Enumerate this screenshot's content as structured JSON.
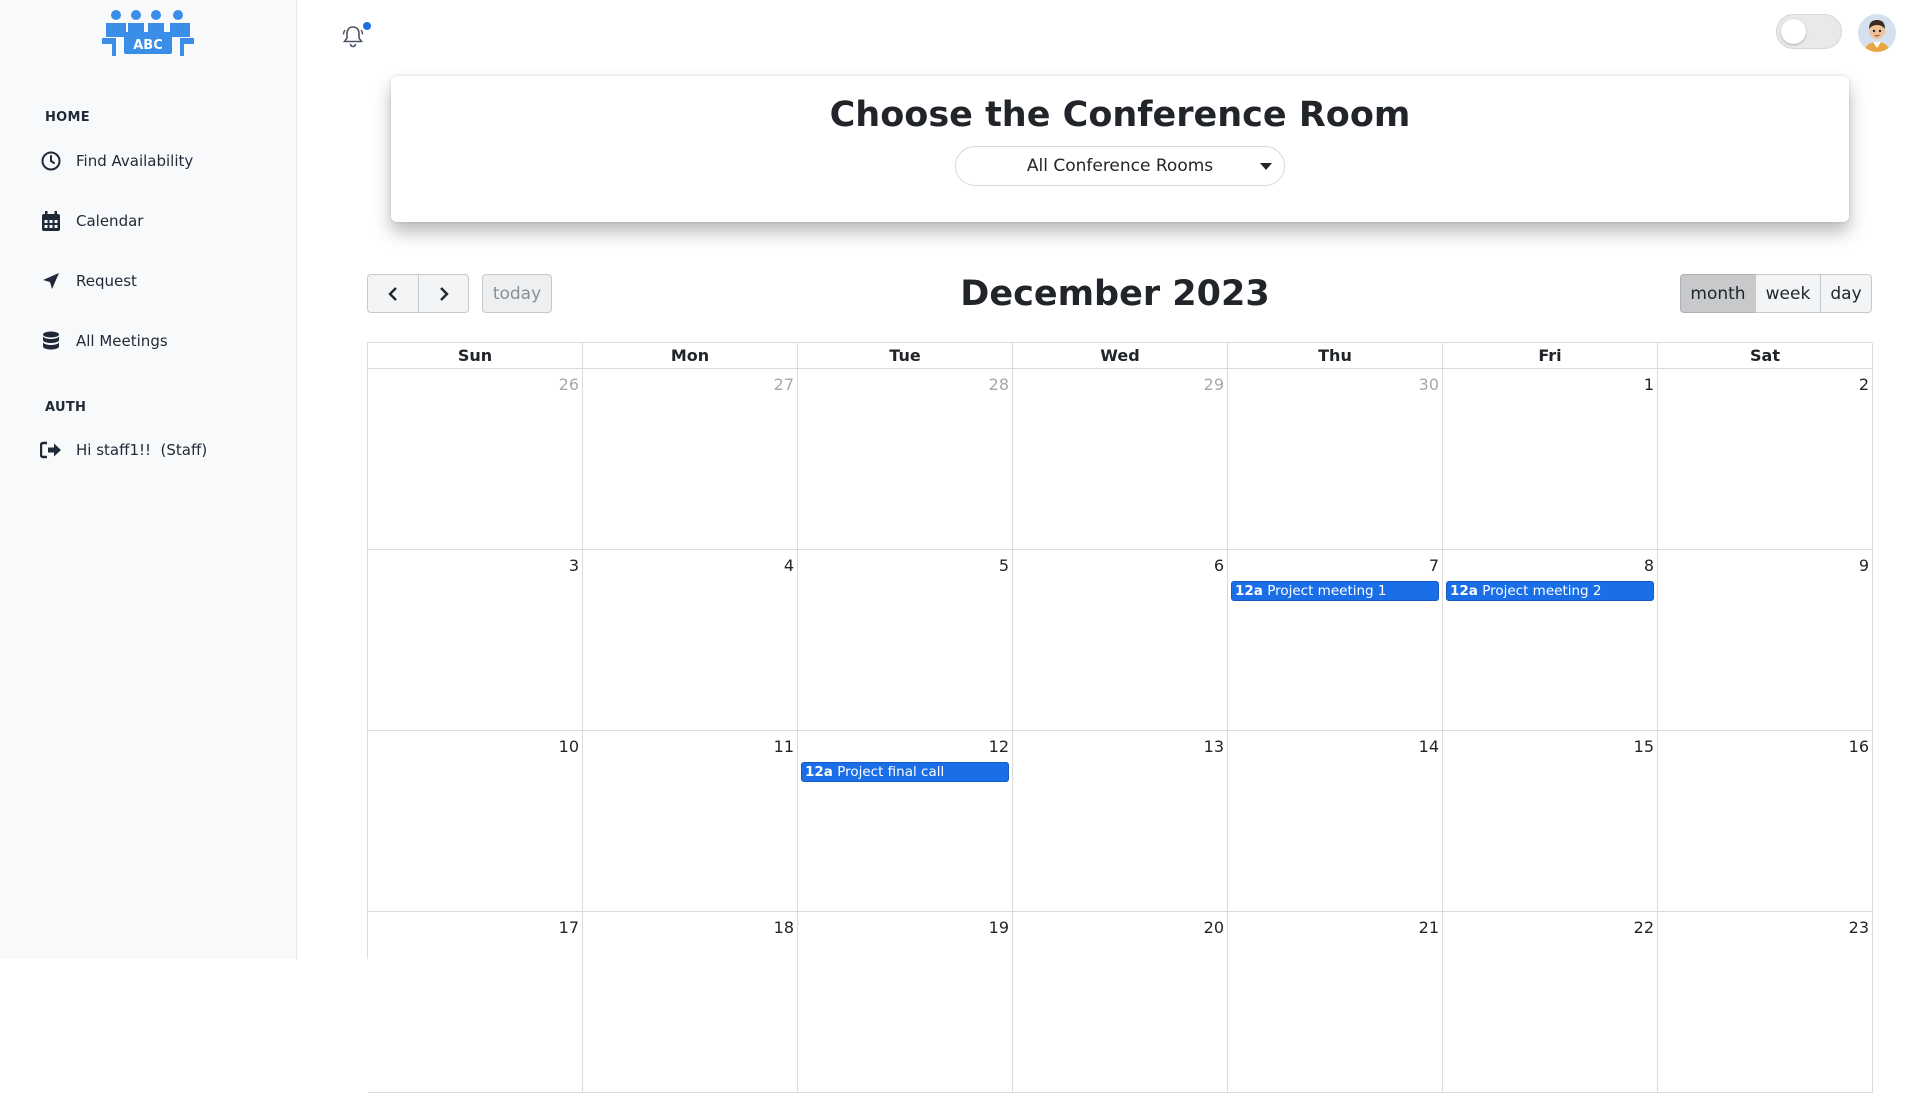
{
  "sidebar": {
    "logo_text": "ABC",
    "sections": [
      {
        "title": "HOME"
      },
      {
        "title": "AUTH"
      }
    ],
    "items": [
      {
        "label": "Find Availability",
        "icon": "clock-icon"
      },
      {
        "label": "Calendar",
        "icon": "calendar-icon"
      },
      {
        "label": "Request",
        "icon": "send-arrow-icon"
      },
      {
        "label": "All Meetings",
        "icon": "database-icon"
      },
      {
        "label": "Hi staff1!!  (Staff)",
        "icon": "sign-out-icon"
      }
    ]
  },
  "topbar": {
    "bell_icon": "bell-icon",
    "theme_toggle": "off",
    "avatar_icon": "user-avatar"
  },
  "room_card": {
    "title": "Choose the Conference Room",
    "selected_room": "All Conference Rooms"
  },
  "calendar": {
    "title": "December 2023",
    "today_label": "today",
    "views": [
      "month",
      "week",
      "day"
    ],
    "active_view": "month",
    "weekdays": [
      "Sun",
      "Mon",
      "Tue",
      "Wed",
      "Thu",
      "Fri",
      "Sat"
    ],
    "weeks": [
      [
        {
          "day": "26",
          "other": true
        },
        {
          "day": "27",
          "other": true
        },
        {
          "day": "28",
          "other": true
        },
        {
          "day": "29",
          "other": true
        },
        {
          "day": "30",
          "other": true
        },
        {
          "day": "1"
        },
        {
          "day": "2"
        }
      ],
      [
        {
          "day": "3"
        },
        {
          "day": "4"
        },
        {
          "day": "5"
        },
        {
          "day": "6"
        },
        {
          "day": "7",
          "event": {
            "time": "12a",
            "title": "Project meeting 1"
          }
        },
        {
          "day": "8",
          "event": {
            "time": "12a",
            "title": "Project meeting 2"
          }
        },
        {
          "day": "9"
        }
      ],
      [
        {
          "day": "10"
        },
        {
          "day": "11"
        },
        {
          "day": "12",
          "event": {
            "time": "12a",
            "title": "Project final call"
          }
        },
        {
          "day": "13"
        },
        {
          "day": "14"
        },
        {
          "day": "15"
        },
        {
          "day": "16"
        }
      ],
      [
        {
          "day": "17"
        },
        {
          "day": "18"
        },
        {
          "day": "19"
        },
        {
          "day": "20"
        },
        {
          "day": "21"
        },
        {
          "day": "22"
        },
        {
          "day": "23"
        }
      ]
    ],
    "event_color": "#1a6fe8"
  }
}
